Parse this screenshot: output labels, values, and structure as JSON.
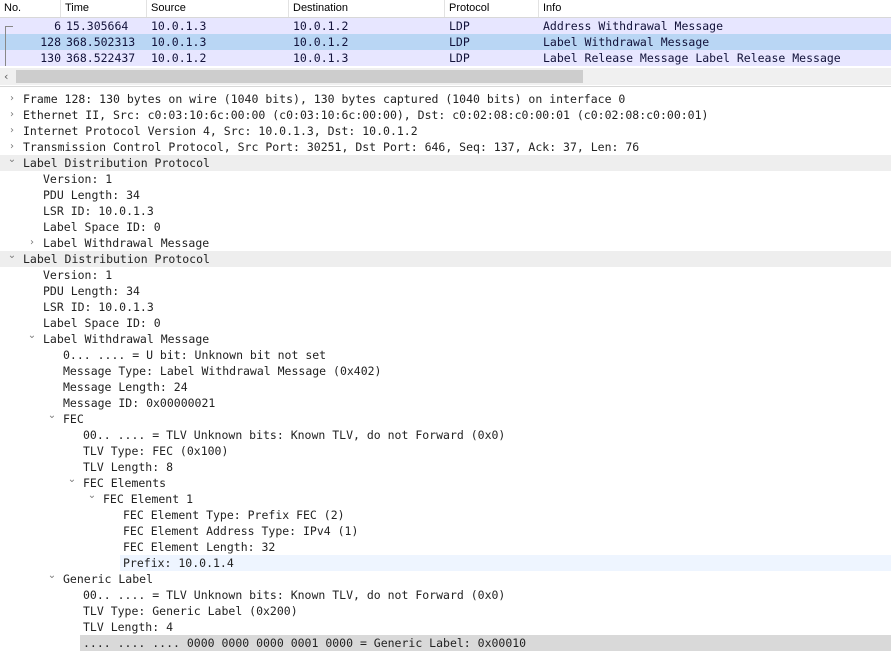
{
  "packet_list": {
    "columns": [
      "No.",
      "Time",
      "Source",
      "Destination",
      "Protocol",
      "Info"
    ],
    "rows": [
      {
        "no": "6",
        "time": "15.305664",
        "src": "10.0.1.3",
        "dst": "10.0.1.2",
        "proto": "LDP",
        "info": "Address Withdrawal Message",
        "bg": "#e7e6ff"
      },
      {
        "no": "128",
        "time": "368.502313",
        "src": "10.0.1.3",
        "dst": "10.0.1.2",
        "proto": "LDP",
        "info": "Label Withdrawal Message",
        "bg": "#b9d6f4"
      },
      {
        "no": "130",
        "time": "368.522437",
        "src": "10.0.1.2",
        "dst": "10.0.1.3",
        "proto": "LDP",
        "info": "Label Release Message Label Release Message",
        "bg": "#e7e6ff"
      }
    ]
  },
  "detail": {
    "rows": [
      {
        "text": "Frame 128: 130 bytes on wire (1040 bits), 130 bytes captured (1040 bits) on interface 0",
        "indent": 0,
        "arrow": "collapsed"
      },
      {
        "text": "Ethernet II, Src: c0:03:10:6c:00:00 (c0:03:10:6c:00:00), Dst: c0:02:08:c0:00:01 (c0:02:08:c0:00:01)",
        "indent": 0,
        "arrow": "collapsed"
      },
      {
        "text": "Internet Protocol Version 4, Src: 10.0.1.3, Dst: 10.0.1.2",
        "indent": 0,
        "arrow": "collapsed"
      },
      {
        "text": "Transmission Control Protocol, Src Port: 30251, Dst Port: 646, Seq: 137, Ack: 37, Len: 76",
        "indent": 0,
        "arrow": "collapsed"
      },
      {
        "text": "Label Distribution Protocol",
        "indent": 0,
        "arrow": "expanded",
        "section": true
      },
      {
        "text": "Version: 1",
        "indent": 1,
        "arrow": "none"
      },
      {
        "text": "PDU Length: 34",
        "indent": 1,
        "arrow": "none"
      },
      {
        "text": "LSR ID: 10.0.1.3",
        "indent": 1,
        "arrow": "none"
      },
      {
        "text": "Label Space ID: 0",
        "indent": 1,
        "arrow": "none"
      },
      {
        "text": "Label Withdrawal Message",
        "indent": 1,
        "arrow": "collapsed"
      },
      {
        "text": "Label Distribution Protocol",
        "indent": 0,
        "arrow": "expanded",
        "section": true
      },
      {
        "text": "Version: 1",
        "indent": 1,
        "arrow": "none"
      },
      {
        "text": "PDU Length: 34",
        "indent": 1,
        "arrow": "none"
      },
      {
        "text": "LSR ID: 10.0.1.3",
        "indent": 1,
        "arrow": "none"
      },
      {
        "text": "Label Space ID: 0",
        "indent": 1,
        "arrow": "none"
      },
      {
        "text": "Label Withdrawal Message",
        "indent": 1,
        "arrow": "expanded"
      },
      {
        "text": "0... .... = U bit: Unknown bit not set",
        "indent": 2,
        "arrow": "none"
      },
      {
        "text": "Message Type: Label Withdrawal Message (0x402)",
        "indent": 2,
        "arrow": "none"
      },
      {
        "text": "Message Length: 24",
        "indent": 2,
        "arrow": "none"
      },
      {
        "text": "Message ID: 0x00000021",
        "indent": 2,
        "arrow": "none"
      },
      {
        "text": "FEC",
        "indent": 2,
        "arrow": "expanded"
      },
      {
        "text": "00.. .... = TLV Unknown bits: Known TLV, do not Forward (0x0)",
        "indent": 3,
        "arrow": "none"
      },
      {
        "text": "TLV Type: FEC (0x100)",
        "indent": 3,
        "arrow": "none"
      },
      {
        "text": "TLV Length: 8",
        "indent": 3,
        "arrow": "none"
      },
      {
        "text": "FEC Elements",
        "indent": 3,
        "arrow": "expanded"
      },
      {
        "text": "FEC Element 1",
        "indent": 4,
        "arrow": "expanded"
      },
      {
        "text": "FEC Element Type: Prefix FEC (2)",
        "indent": 5,
        "arrow": "none"
      },
      {
        "text": "FEC Element Address Type: IPv4 (1)",
        "indent": 5,
        "arrow": "none"
      },
      {
        "text": "FEC Element Length: 32",
        "indent": 5,
        "arrow": "none"
      },
      {
        "text": "Prefix: 10.0.1.4",
        "indent": 5,
        "arrow": "none",
        "highlight": "#eef5ff"
      },
      {
        "text": "Generic Label",
        "indent": 2,
        "arrow": "expanded"
      },
      {
        "text": "00.. .... = TLV Unknown bits: Known TLV, do not Forward (0x0)",
        "indent": 3,
        "arrow": "none"
      },
      {
        "text": "TLV Type: Generic Label (0x200)",
        "indent": 3,
        "arrow": "none"
      },
      {
        "text": "TLV Length: 4",
        "indent": 3,
        "arrow": "none"
      },
      {
        "text": ".... .... .... 0000 0000 0000 0001 0000 = Generic Label: 0x00010",
        "indent": 3,
        "arrow": "none",
        "highlight": "#d9d9d9"
      }
    ]
  },
  "icons": {
    "collapsed": "chevron-right-icon",
    "expanded": "chevron-down-icon",
    "scroll_left": "chevron-left-icon"
  },
  "glyphs": {
    "collapsed": "›",
    "expanded": "⌄",
    "scroll_left": "‹"
  }
}
